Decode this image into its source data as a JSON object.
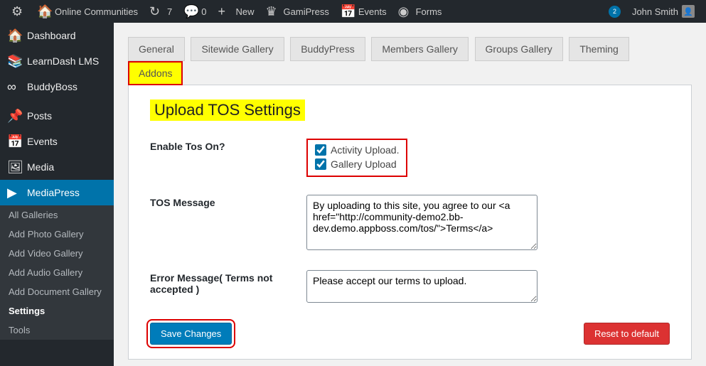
{
  "topbar": {
    "site_name": "Online Communities",
    "updates_count": "7",
    "comments_count": "0",
    "new_label": "New",
    "gamipress_label": "GamiPress",
    "events_label": "Events",
    "forms_label": "Forms",
    "notif_count": "2",
    "user_name": "John Smith"
  },
  "sidebar": {
    "items": [
      {
        "label": "Dashboard"
      },
      {
        "label": "LearnDash LMS"
      },
      {
        "label": "BuddyBoss"
      },
      {
        "label": "Posts"
      },
      {
        "label": "Events"
      },
      {
        "label": "Media"
      },
      {
        "label": "MediaPress"
      }
    ],
    "submenu": [
      {
        "label": "All Galleries"
      },
      {
        "label": "Add Photo Gallery"
      },
      {
        "label": "Add Video Gallery"
      },
      {
        "label": "Add Audio Gallery"
      },
      {
        "label": "Add Document Gallery"
      },
      {
        "label": "Settings"
      },
      {
        "label": "Tools"
      }
    ]
  },
  "tabs": [
    {
      "label": "General"
    },
    {
      "label": "Sitewide Gallery"
    },
    {
      "label": "BuddyPress"
    },
    {
      "label": "Members Gallery"
    },
    {
      "label": "Groups Gallery"
    },
    {
      "label": "Theming"
    },
    {
      "label": "Addons"
    }
  ],
  "page": {
    "heading": "Upload TOS Settings",
    "enable_label": "Enable Tos On?",
    "checkbox_activity": "Activity Upload.",
    "checkbox_gallery": "Gallery Upload",
    "tos_message_label": "TOS Message",
    "tos_message_value": "By uploading to this site, you agree to our <a href=\"http://community-demo2.bb-dev.demo.appboss.com/tos/\">Terms</a>",
    "error_label": "Error Message( Terms not accepted )",
    "error_value": "Please accept our terms to upload.",
    "save_label": "Save Changes",
    "reset_label": "Reset to default"
  }
}
